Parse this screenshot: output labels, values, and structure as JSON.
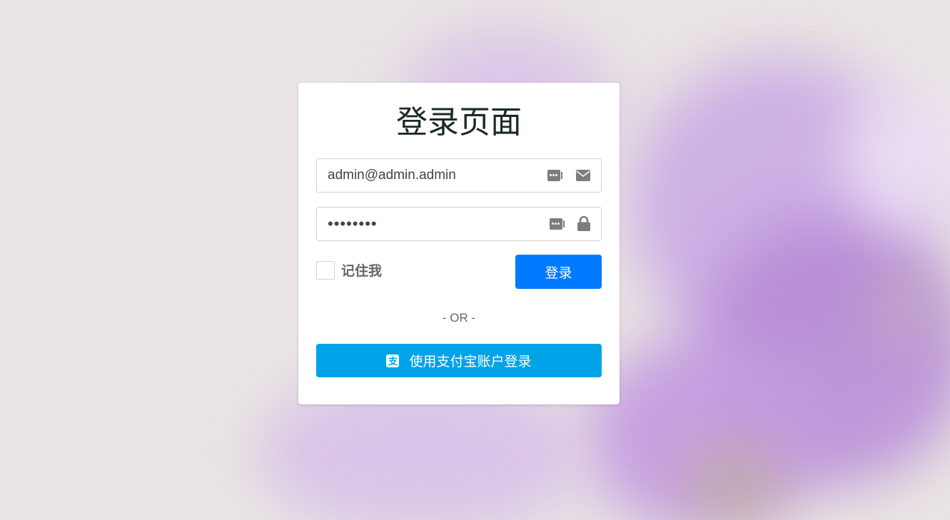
{
  "page": {
    "title": "登录页面"
  },
  "email_field": {
    "value": "admin@admin.admin",
    "icon": "envelope-icon",
    "autofill_icon": "password-manager-icon"
  },
  "password_field": {
    "value": "••••••••",
    "icon": "lock-icon",
    "autofill_icon": "password-manager-icon"
  },
  "remember": {
    "label": "记住我",
    "checked": false
  },
  "login_button": {
    "label": "登录",
    "color": "#007bff"
  },
  "divider": {
    "text": "- OR -"
  },
  "alipay_button": {
    "label": "使用支付宝账户登录",
    "icon_glyph": "支",
    "icon": "alipay-icon",
    "color": "#00a3e8"
  }
}
